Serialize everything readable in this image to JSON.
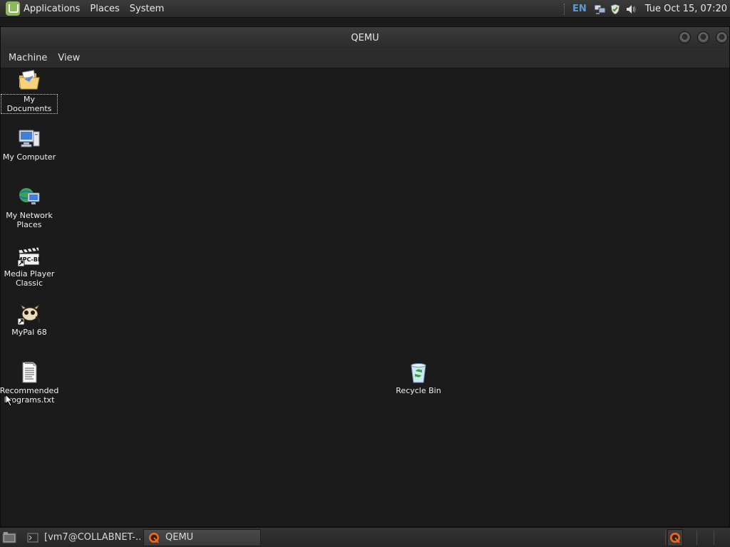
{
  "top_panel": {
    "menus": [
      "Applications",
      "Places",
      "System"
    ],
    "tray": {
      "keyboard_layout": "EN",
      "icons": [
        "network-icon",
        "shield-icon",
        "volume-icon"
      ],
      "clock": "Tue Oct 15, 07:20"
    }
  },
  "window": {
    "title": "QEMU",
    "menus": [
      "Machine",
      "View"
    ]
  },
  "desktop": {
    "icons": [
      {
        "label": "My Documents",
        "icon": "folder-documents-icon",
        "selected": true
      },
      {
        "label": "My Computer",
        "icon": "computer-icon"
      },
      {
        "label": "My Network Places",
        "icon": "network-places-icon"
      },
      {
        "label": "Media Player Classic",
        "icon": "media-player-icon",
        "shortcut": true
      },
      {
        "label": "MyPal 68",
        "icon": "mypal-icon",
        "shortcut": true
      },
      {
        "label": "Recommended Programs.txt",
        "icon": "text-file-icon"
      },
      {
        "label": "Recycle Bin",
        "icon": "recycle-bin-icon"
      }
    ]
  },
  "taskbar": {
    "tasks": [
      {
        "label": "[vm7@COLLABNET-...",
        "icon": "terminal-icon",
        "active": false
      },
      {
        "label": "QEMU",
        "icon": "qemu-icon",
        "active": true
      }
    ]
  },
  "colors": {
    "desktop_bg": "#1b1b1b",
    "panel_bg": "#2c2c2c",
    "accent_en": "#5b9bd5",
    "mint_green": "#8ab85a"
  }
}
